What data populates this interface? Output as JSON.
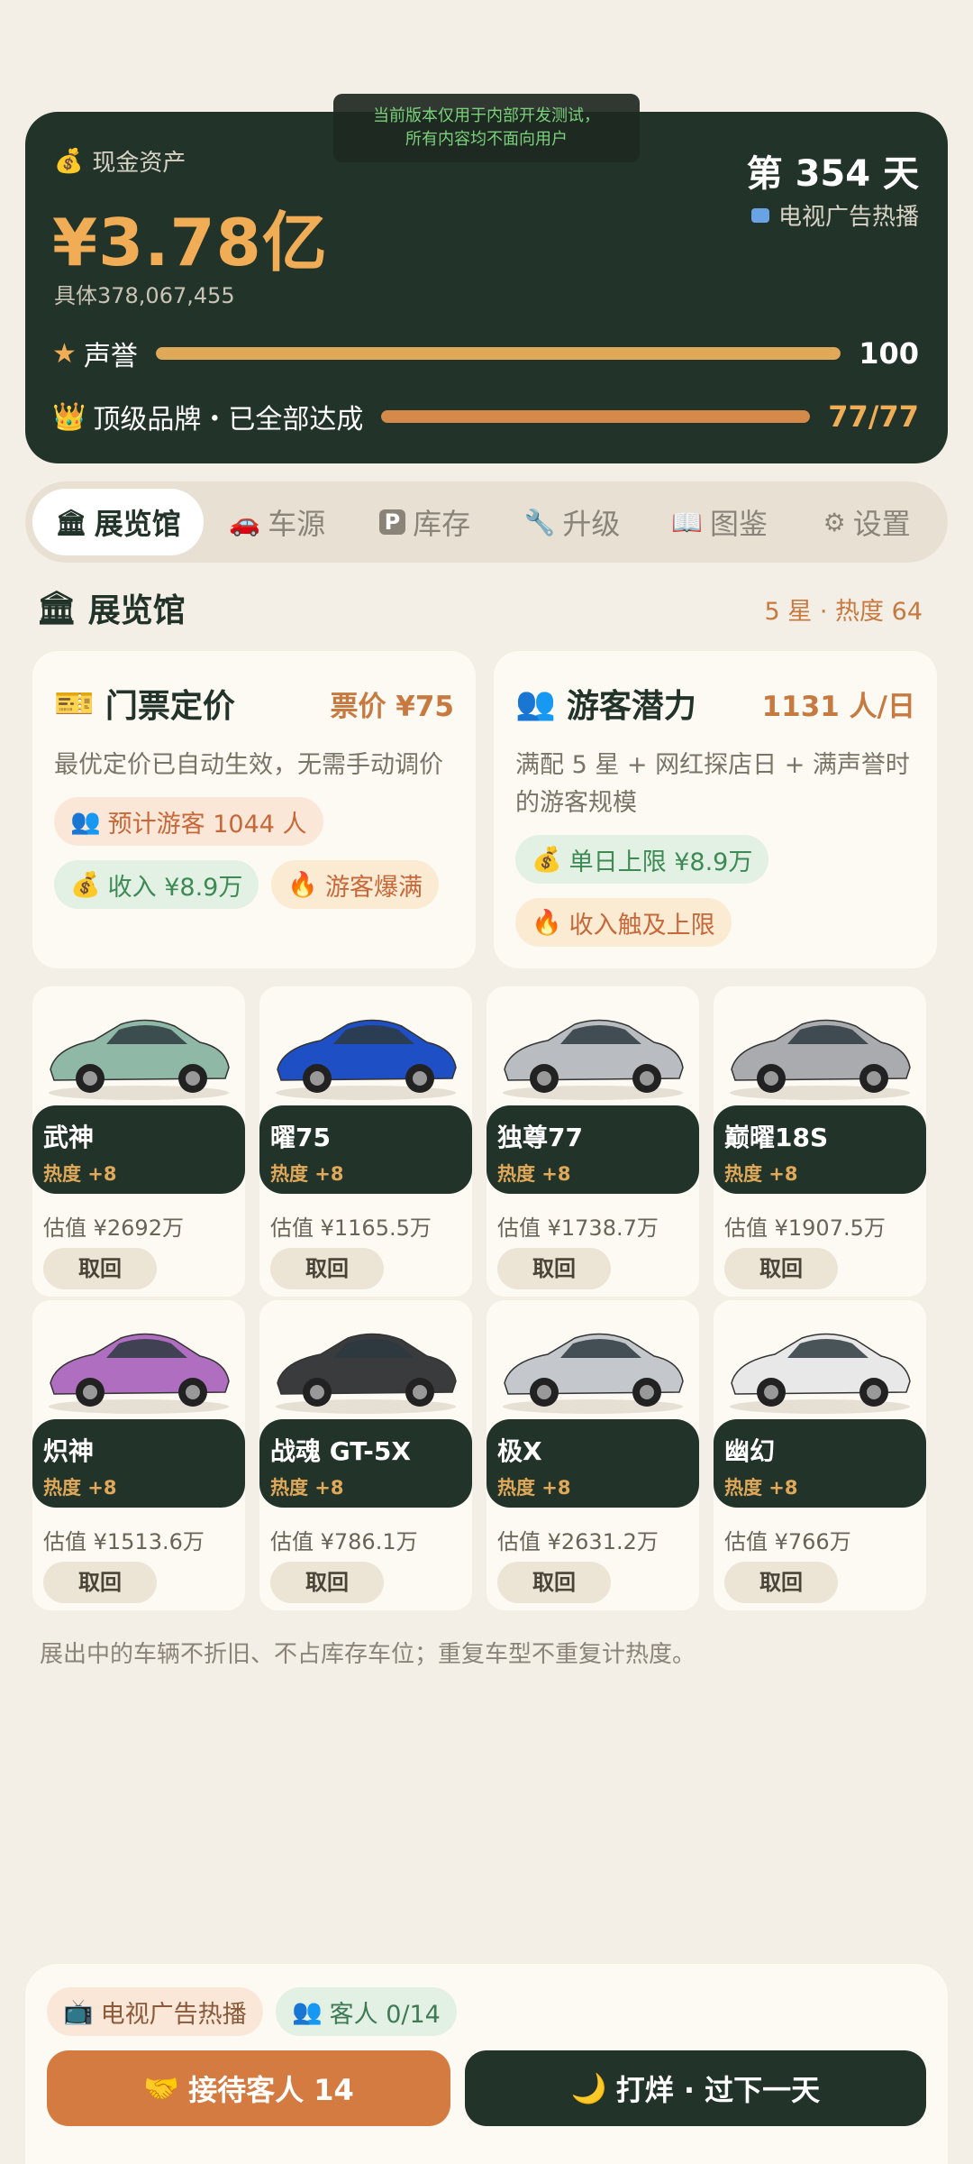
{
  "toast": {
    "line1": "当前版本仅用于内部开发测试，",
    "line2": "所有内容均不面向用户"
  },
  "stats": {
    "cash_label": "现金资产",
    "cash_value": "¥3.78亿",
    "cash_detail": "具体378,067,455",
    "day": "第 354 天",
    "ad_status": "电视广告热播",
    "reputation_label": "声誉",
    "reputation_value": "100",
    "reputation_fraction": 1.0,
    "brand_label": "顶级品牌・已全部达成",
    "brand_value": "77/77",
    "brand_fraction": 1.0
  },
  "tabs": [
    {
      "icon": "🏛",
      "label": "展览馆",
      "active": true
    },
    {
      "icon": "🚗",
      "label": "车源"
    },
    {
      "icon": "P",
      "label": "库存"
    },
    {
      "icon": "🔧",
      "label": "升级"
    },
    {
      "icon": "📖",
      "label": "图鉴"
    },
    {
      "icon": "⚙",
      "label": "设置"
    }
  ],
  "section": {
    "title": "展览馆",
    "meta": "5 星 · 热度 64"
  },
  "ticket": {
    "title": "门票定价",
    "value": "票价 ¥75",
    "desc": "最优定价已自动生效，无需手动调价",
    "chips": [
      "预计游客 1044 人",
      "收入 ¥8.9万",
      "游客爆满"
    ]
  },
  "visitor": {
    "title": "游客潜力",
    "value": "1131 人/日",
    "desc": "满配 5 星 + 网红探店日 + 满声誉时的游客规模",
    "chips": [
      "单日上限 ¥8.9万",
      "收入触及上限"
    ]
  },
  "cars": [
    {
      "name": "武神",
      "heat": "热度 +8",
      "value": "估值 ¥2692万",
      "action": "取回",
      "color": "#8fb8a6"
    },
    {
      "name": "曜75",
      "heat": "热度 +8",
      "value": "估值 ¥1165.5万",
      "action": "取回",
      "color": "#1f4fc4"
    },
    {
      "name": "独尊77",
      "heat": "热度 +8",
      "value": "估值 ¥1738.7万",
      "action": "取回",
      "color": "#b9bcc0"
    },
    {
      "name": "巅曜18S",
      "heat": "热度 +8",
      "value": "估值 ¥1907.5万",
      "action": "取回",
      "color": "#a9abae"
    },
    {
      "name": "炽神",
      "heat": "热度 +8",
      "value": "估值 ¥1513.6万",
      "action": "取回",
      "color": "#b06ec0"
    },
    {
      "name": "战魂 GT-5X",
      "heat": "热度 +8",
      "value": "估值 ¥786.1万",
      "action": "取回",
      "color": "#3a3b3d"
    },
    {
      "name": "极X",
      "heat": "热度 +8",
      "value": "估值 ¥2631.2万",
      "action": "取回",
      "color": "#c4c8cc"
    },
    {
      "name": "幽幻",
      "heat": "热度 +8",
      "value": "估值 ¥766万",
      "action": "取回",
      "color": "#e8e8e8"
    }
  ],
  "footnote": "展出中的车辆不折旧、不占库存车位；重复车型不重复计热度。",
  "bottom": {
    "ad_chip": "电视广告热播",
    "guests_chip": "客人 0/14",
    "serve_button": "接待客人 14",
    "close_button": "打烊 · 过下一天"
  }
}
